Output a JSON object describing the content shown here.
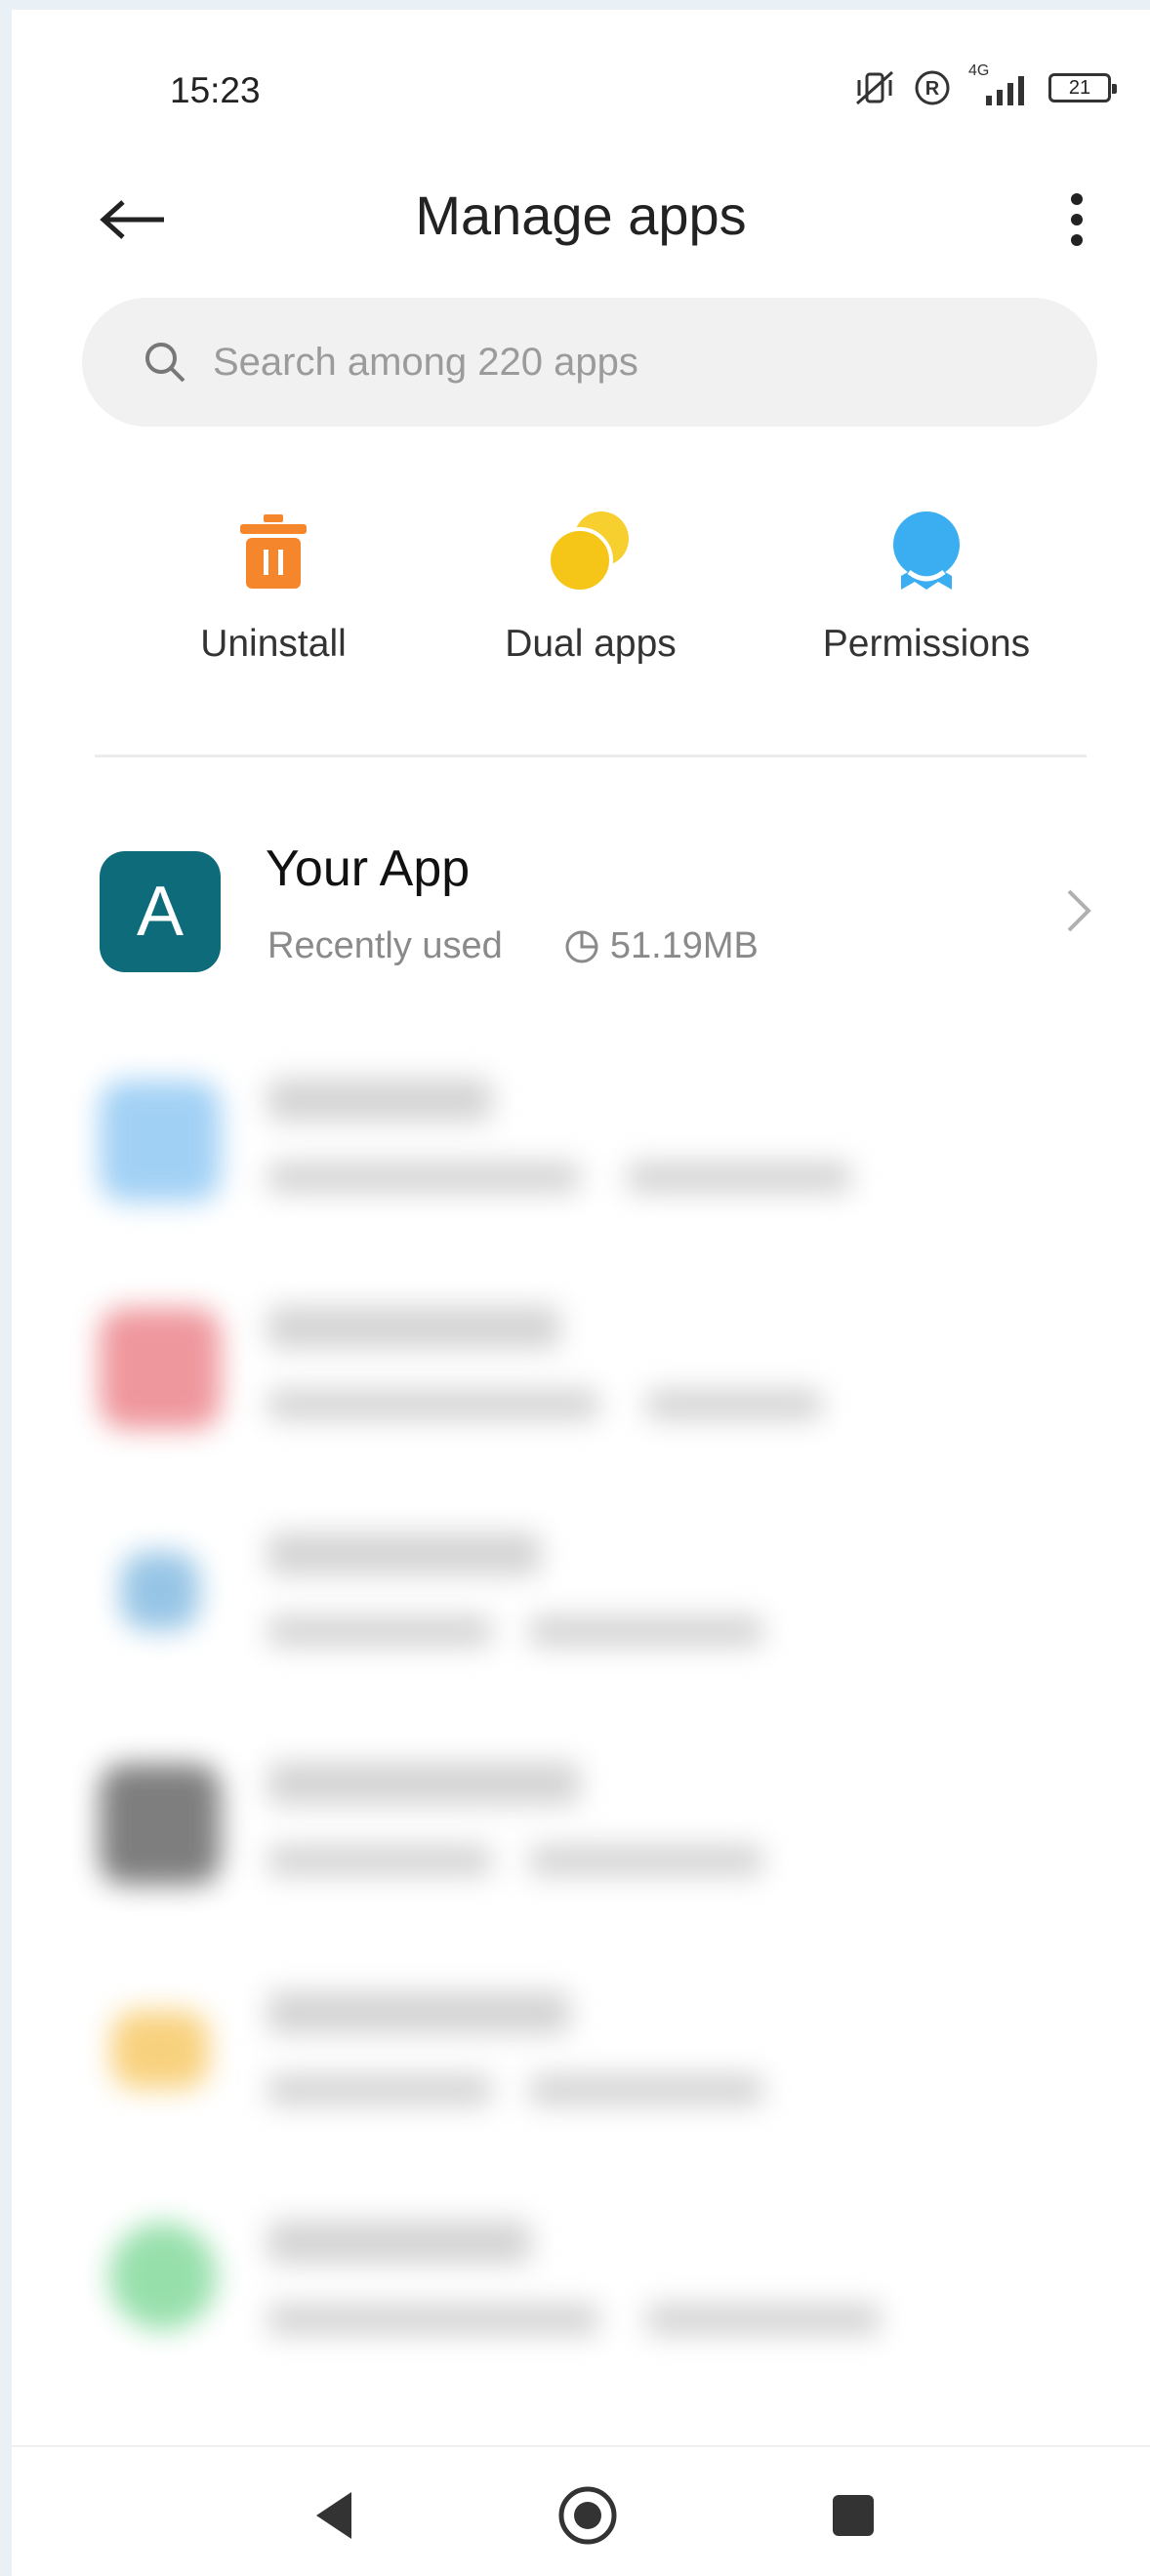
{
  "status_bar": {
    "time": "15:23",
    "network": "4G",
    "battery": "21"
  },
  "header": {
    "title": "Manage apps"
  },
  "search": {
    "placeholder": "Search among 220 apps"
  },
  "actions": [
    {
      "label": "Uninstall",
      "icon": "trash-icon",
      "color": "#f5862b"
    },
    {
      "label": "Dual apps",
      "icon": "dual-circles-icon",
      "color": "#f5c518"
    },
    {
      "label": "Permissions",
      "icon": "person-badge-icon",
      "color": "#3aaef0"
    }
  ],
  "apps": [
    {
      "name": "Your App",
      "icon_letter": "A",
      "status": "Recently used",
      "size": "51.19MB",
      "icon_color": "#0e6b7a"
    }
  ],
  "blurred_app_icon_colors": [
    "#6fb8f0",
    "#e66068",
    "#5fa6d8",
    "#3a3a3a",
    "#f5b93a",
    "#5fcf7f"
  ]
}
